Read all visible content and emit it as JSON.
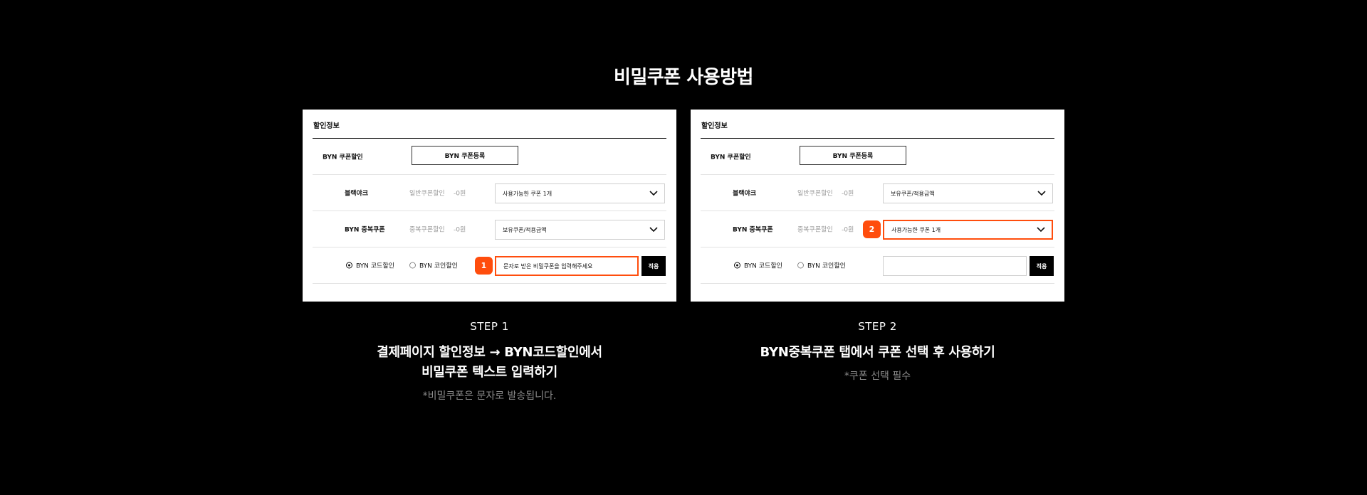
{
  "title": "비밀쿠폰 사용방법",
  "colors": {
    "accent": "#ff4d0d",
    "background": "#000000"
  },
  "panels": [
    {
      "header": "할인정보",
      "coupon_label": "BYN 쿠폰할인",
      "register_button": "BYN 쿠폰등록",
      "row1": {
        "label": "블랙야크",
        "type": "일반쿠폰할인",
        "amount": "-0원",
        "select": "사용가능한 쿠폰 1개"
      },
      "row2": {
        "label": "BYN 중복쿠폰",
        "type": "중복쿠폰할인",
        "amount": "-0원",
        "select": "보유쿠폰/적용금액"
      },
      "radio_code": "BYN 코드할인",
      "radio_coin": "BYN 코인할인",
      "badge": "1",
      "input_value": "문자로 받은 비밀쿠폰을 입력해주세요",
      "apply": "적용"
    },
    {
      "header": "할인정보",
      "coupon_label": "BYN 쿠폰할인",
      "register_button": "BYN 쿠폰등록",
      "row1": {
        "label": "블랙야크",
        "type": "일반쿠폰할인",
        "amount": "-0원",
        "select": "보유쿠폰/적용금액"
      },
      "row2": {
        "label": "BYN 중복쿠폰",
        "type": "중복쿠폰할인",
        "amount": "-0원",
        "select": "사용가능한 쿠폰 1개"
      },
      "radio_code": "BYN 코드할인",
      "radio_coin": "BYN 코인할인",
      "badge": "2",
      "input_value": "",
      "apply": "적용"
    }
  ],
  "steps": [
    {
      "step": "STEP 1",
      "line1": "결제페이지 할인정보 → BYN코드할인에서",
      "line2": "비밀쿠폰 텍스트 입력하기",
      "note": "*비밀쿠폰은 문자로 발송됩니다."
    },
    {
      "step": "STEP 2",
      "line1": "BYN중복쿠폰 탭에서 쿠폰 선택 후 사용하기",
      "line2": "",
      "note": "*쿠폰 선택 필수"
    }
  ]
}
